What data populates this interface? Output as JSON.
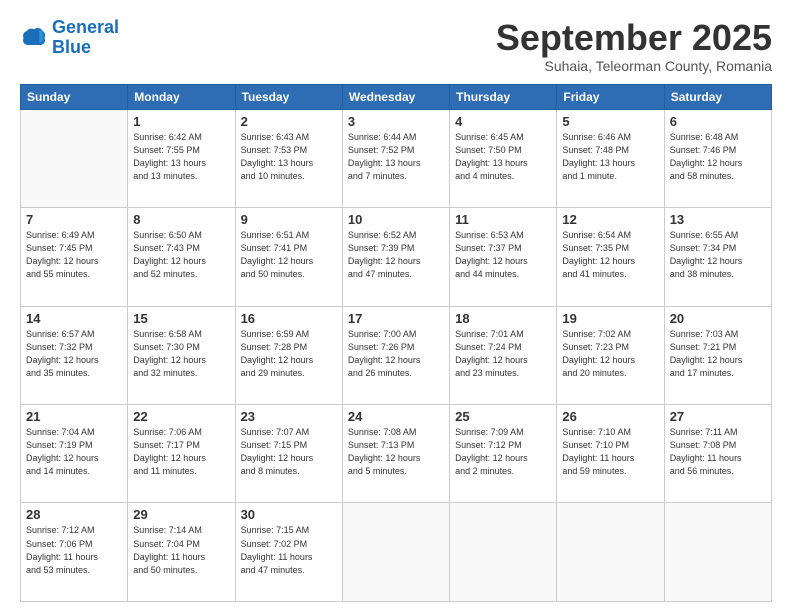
{
  "logo": {
    "line1": "General",
    "line2": "Blue"
  },
  "title": "September 2025",
  "subtitle": "Suhaia, Teleorman County, Romania",
  "weekdays": [
    "Sunday",
    "Monday",
    "Tuesday",
    "Wednesday",
    "Thursday",
    "Friday",
    "Saturday"
  ],
  "weeks": [
    [
      {
        "day": "",
        "info": ""
      },
      {
        "day": "1",
        "info": "Sunrise: 6:42 AM\nSunset: 7:55 PM\nDaylight: 13 hours\nand 13 minutes."
      },
      {
        "day": "2",
        "info": "Sunrise: 6:43 AM\nSunset: 7:53 PM\nDaylight: 13 hours\nand 10 minutes."
      },
      {
        "day": "3",
        "info": "Sunrise: 6:44 AM\nSunset: 7:52 PM\nDaylight: 13 hours\nand 7 minutes."
      },
      {
        "day": "4",
        "info": "Sunrise: 6:45 AM\nSunset: 7:50 PM\nDaylight: 13 hours\nand 4 minutes."
      },
      {
        "day": "5",
        "info": "Sunrise: 6:46 AM\nSunset: 7:48 PM\nDaylight: 13 hours\nand 1 minute."
      },
      {
        "day": "6",
        "info": "Sunrise: 6:48 AM\nSunset: 7:46 PM\nDaylight: 12 hours\nand 58 minutes."
      }
    ],
    [
      {
        "day": "7",
        "info": "Sunrise: 6:49 AM\nSunset: 7:45 PM\nDaylight: 12 hours\nand 55 minutes."
      },
      {
        "day": "8",
        "info": "Sunrise: 6:50 AM\nSunset: 7:43 PM\nDaylight: 12 hours\nand 52 minutes."
      },
      {
        "day": "9",
        "info": "Sunrise: 6:51 AM\nSunset: 7:41 PM\nDaylight: 12 hours\nand 50 minutes."
      },
      {
        "day": "10",
        "info": "Sunrise: 6:52 AM\nSunset: 7:39 PM\nDaylight: 12 hours\nand 47 minutes."
      },
      {
        "day": "11",
        "info": "Sunrise: 6:53 AM\nSunset: 7:37 PM\nDaylight: 12 hours\nand 44 minutes."
      },
      {
        "day": "12",
        "info": "Sunrise: 6:54 AM\nSunset: 7:35 PM\nDaylight: 12 hours\nand 41 minutes."
      },
      {
        "day": "13",
        "info": "Sunrise: 6:55 AM\nSunset: 7:34 PM\nDaylight: 12 hours\nand 38 minutes."
      }
    ],
    [
      {
        "day": "14",
        "info": "Sunrise: 6:57 AM\nSunset: 7:32 PM\nDaylight: 12 hours\nand 35 minutes."
      },
      {
        "day": "15",
        "info": "Sunrise: 6:58 AM\nSunset: 7:30 PM\nDaylight: 12 hours\nand 32 minutes."
      },
      {
        "day": "16",
        "info": "Sunrise: 6:59 AM\nSunset: 7:28 PM\nDaylight: 12 hours\nand 29 minutes."
      },
      {
        "day": "17",
        "info": "Sunrise: 7:00 AM\nSunset: 7:26 PM\nDaylight: 12 hours\nand 26 minutes."
      },
      {
        "day": "18",
        "info": "Sunrise: 7:01 AM\nSunset: 7:24 PM\nDaylight: 12 hours\nand 23 minutes."
      },
      {
        "day": "19",
        "info": "Sunrise: 7:02 AM\nSunset: 7:23 PM\nDaylight: 12 hours\nand 20 minutes."
      },
      {
        "day": "20",
        "info": "Sunrise: 7:03 AM\nSunset: 7:21 PM\nDaylight: 12 hours\nand 17 minutes."
      }
    ],
    [
      {
        "day": "21",
        "info": "Sunrise: 7:04 AM\nSunset: 7:19 PM\nDaylight: 12 hours\nand 14 minutes."
      },
      {
        "day": "22",
        "info": "Sunrise: 7:06 AM\nSunset: 7:17 PM\nDaylight: 12 hours\nand 11 minutes."
      },
      {
        "day": "23",
        "info": "Sunrise: 7:07 AM\nSunset: 7:15 PM\nDaylight: 12 hours\nand 8 minutes."
      },
      {
        "day": "24",
        "info": "Sunrise: 7:08 AM\nSunset: 7:13 PM\nDaylight: 12 hours\nand 5 minutes."
      },
      {
        "day": "25",
        "info": "Sunrise: 7:09 AM\nSunset: 7:12 PM\nDaylight: 12 hours\nand 2 minutes."
      },
      {
        "day": "26",
        "info": "Sunrise: 7:10 AM\nSunset: 7:10 PM\nDaylight: 11 hours\nand 59 minutes."
      },
      {
        "day": "27",
        "info": "Sunrise: 7:11 AM\nSunset: 7:08 PM\nDaylight: 11 hours\nand 56 minutes."
      }
    ],
    [
      {
        "day": "28",
        "info": "Sunrise: 7:12 AM\nSunset: 7:06 PM\nDaylight: 11 hours\nand 53 minutes."
      },
      {
        "day": "29",
        "info": "Sunrise: 7:14 AM\nSunset: 7:04 PM\nDaylight: 11 hours\nand 50 minutes."
      },
      {
        "day": "30",
        "info": "Sunrise: 7:15 AM\nSunset: 7:02 PM\nDaylight: 11 hours\nand 47 minutes."
      },
      {
        "day": "",
        "info": ""
      },
      {
        "day": "",
        "info": ""
      },
      {
        "day": "",
        "info": ""
      },
      {
        "day": "",
        "info": ""
      }
    ]
  ]
}
